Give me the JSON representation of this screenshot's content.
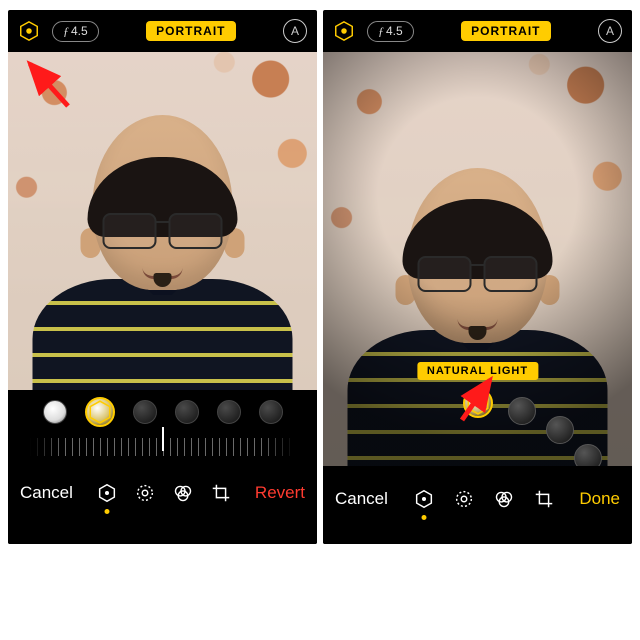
{
  "common": {
    "aperture": "4.5",
    "portrait_badge": "PORTRAIT",
    "markup_glyph": "A"
  },
  "left": {
    "cancel": "Cancel",
    "revert": "Revert"
  },
  "right": {
    "lighting_label": "NATURAL LIGHT",
    "cancel": "Cancel",
    "done": "Done"
  }
}
